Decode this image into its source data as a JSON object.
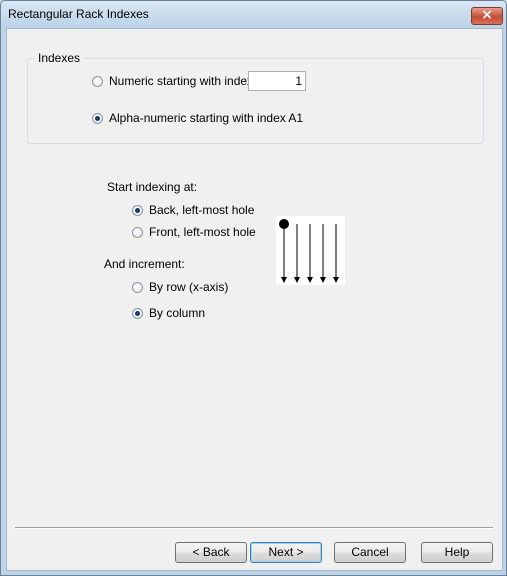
{
  "window": {
    "title": "Rectangular Rack Indexes",
    "close_label": "×"
  },
  "indexes": {
    "group_label": "Indexes",
    "numeric_label": "Numeric starting with index:",
    "numeric_value": "1",
    "numeric_selected": false,
    "alpha_label": "Alpha-numeric starting with index A1",
    "alpha_selected": true
  },
  "start": {
    "heading": "Start indexing at:",
    "options": [
      {
        "label": "Back, left-most hole",
        "selected": true
      },
      {
        "label": "Front, left-most hole",
        "selected": false
      }
    ]
  },
  "increment": {
    "heading": "And increment:",
    "options": [
      {
        "label": "By row (x-axis)",
        "selected": false
      },
      {
        "label": "By column",
        "selected": true
      }
    ]
  },
  "buttons": {
    "back": "< Back",
    "next": "Next >",
    "cancel": "Cancel",
    "help": "Help"
  }
}
